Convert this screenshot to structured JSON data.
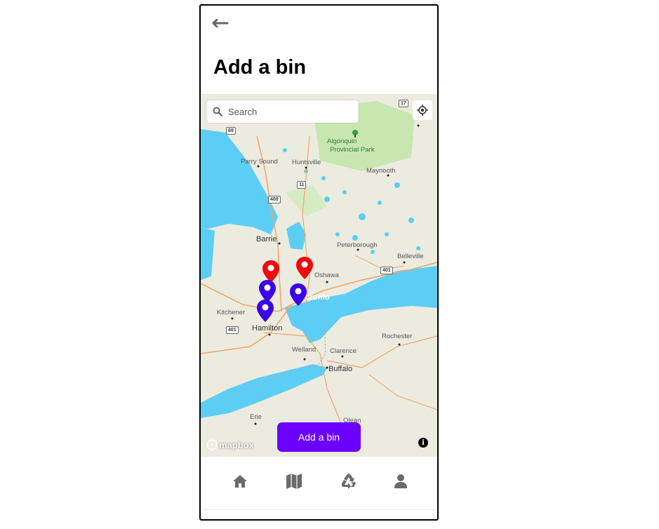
{
  "header": {
    "back_icon": "arrow-left-icon",
    "title": "Add a bin"
  },
  "map": {
    "search": {
      "placeholder": "Search",
      "value": ""
    },
    "labels": {
      "algonquin": "Algonquin",
      "provincial_park": "Provincial Park",
      "parry_sound": "Parry Sound",
      "huntsville": "Huntsville",
      "maynooth": "Maynooth",
      "barrie": "Barrie",
      "peterborough": "Peterborough",
      "belleville": "Belleville",
      "oshawa": "Oshawa",
      "toronto": "Toronto",
      "kitchener": "Kitchener",
      "hamilton": "Hamilton",
      "rochester": "Rochester",
      "welland": "Welland",
      "clarence": "Clarence",
      "buffalo": "Buffalo",
      "erie": "Erie",
      "olean": "Olean"
    },
    "shields": {
      "s17": "17",
      "s69": "69",
      "s11": "11",
      "s400": "400",
      "s401a": "401",
      "s401b": "401"
    },
    "attribution": "mapbox",
    "pins": [
      {
        "name": "pin-red-1",
        "color": "#f00a0a"
      },
      {
        "name": "pin-red-2",
        "color": "#f00a0a"
      },
      {
        "name": "pin-blue-1",
        "color": "#3a00e8"
      },
      {
        "name": "pin-blue-2",
        "color": "#3a00e8"
      },
      {
        "name": "pin-blue-3",
        "color": "#3a00e8"
      }
    ],
    "add_button": "Add a bin"
  },
  "tabbar": {
    "items": [
      {
        "name": "home",
        "icon": "home-icon"
      },
      {
        "name": "map",
        "icon": "map-icon"
      },
      {
        "name": "recycle",
        "icon": "recycle-icon"
      },
      {
        "name": "profile",
        "icon": "user-icon"
      }
    ]
  },
  "colors": {
    "accent": "#6b00ff",
    "water": "#5ccef5",
    "land": "#ecebe0",
    "park": "#c8e6b0",
    "pin_red": "#f00a0a",
    "pin_blue": "#3a00e8"
  }
}
